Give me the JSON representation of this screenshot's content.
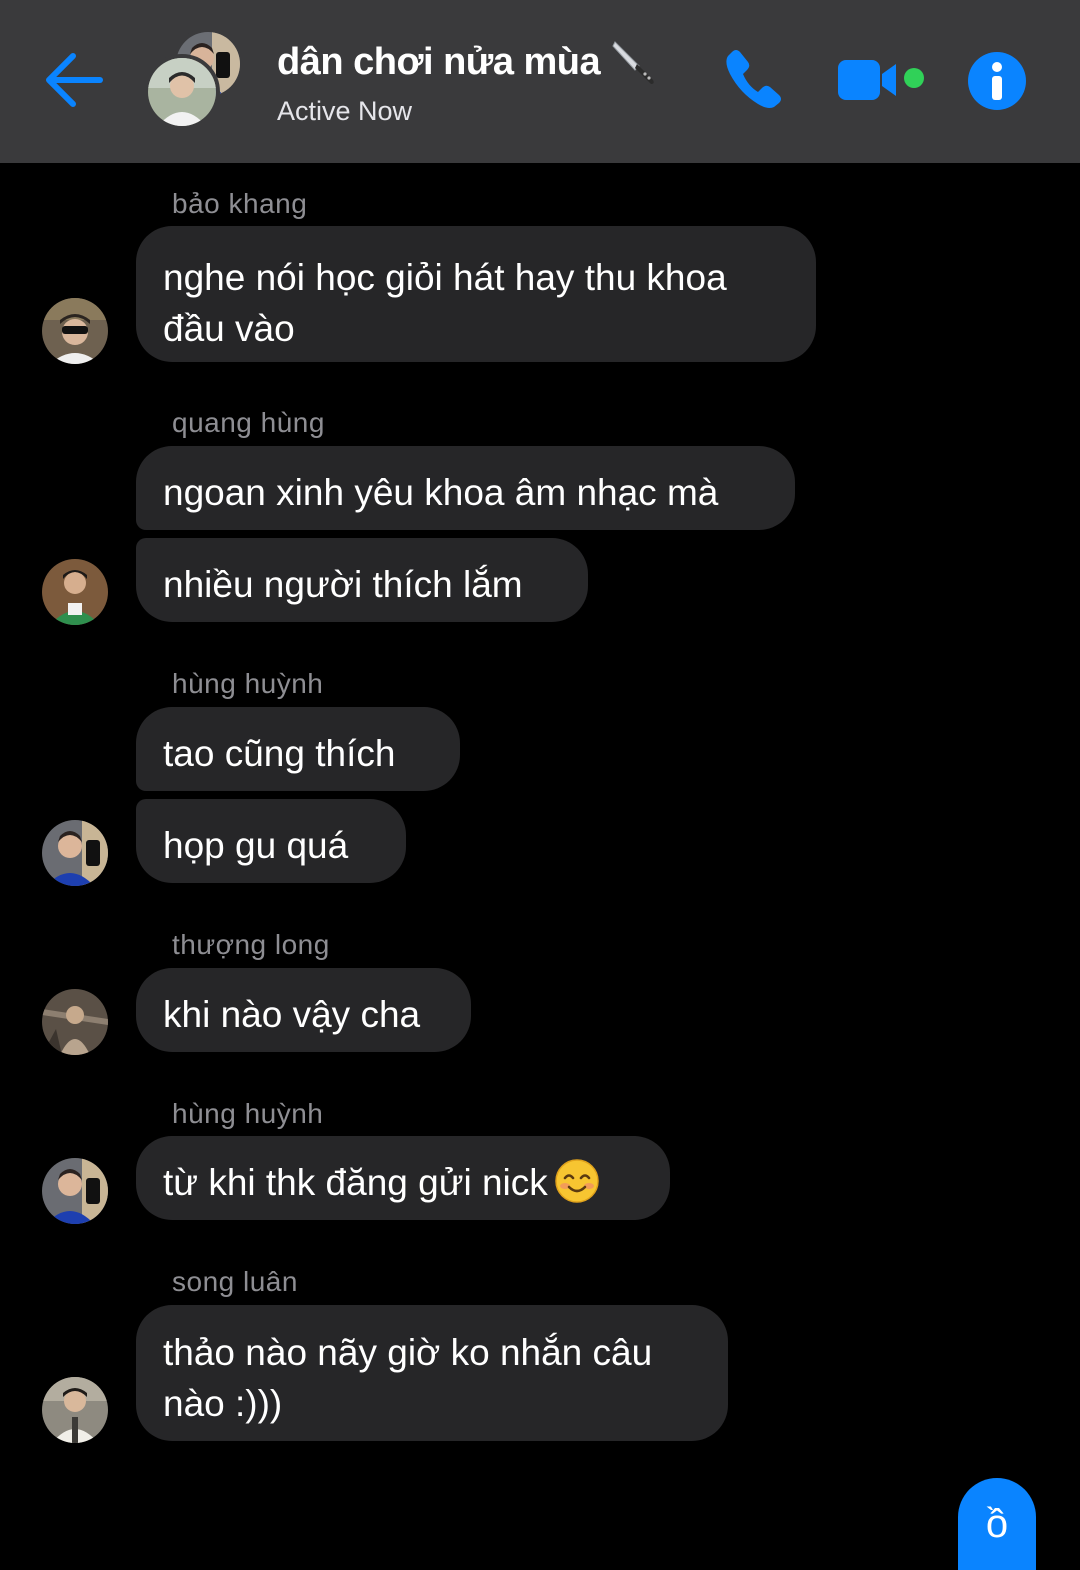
{
  "colors": {
    "header_bg": "#3a3a3c",
    "background": "#000000",
    "accent": "#0a84ff",
    "bubble_bg": "#262628",
    "online_dot": "#30d158",
    "sender_name": "#8e8e93"
  },
  "header": {
    "back_icon": "back-arrow-icon",
    "title": "dân chơi nửa mùa",
    "title_icon": "knife-emoji",
    "status": "Active Now",
    "actions": [
      "phone-icon",
      "video-camera-icon",
      "info-icon"
    ]
  },
  "messages": [
    {
      "sender": "bảo khang",
      "bubbles": [
        "nghe nói học giỏi hát hay thu khoa",
        "đầu vào"
      ]
    },
    {
      "sender": "quang hùng",
      "bubbles": [
        "ngoan xinh yêu khoa âm nhạc mà",
        "nhiều người thích lắm"
      ]
    },
    {
      "sender": "hùng huỳnh",
      "bubbles": [
        "tao cũng thích",
        "họp gu quá"
      ]
    },
    {
      "sender": "thượng long",
      "bubbles": [
        "khi nào vậy cha"
      ]
    },
    {
      "sender": "hùng huỳnh",
      "bubbles": [
        "từ khi thk đăng gửi nick"
      ],
      "emoji": "smiling-face-emoji"
    },
    {
      "sender": "song luân",
      "bubbles": [
        "thảo nào nãy giờ ko nhắn câu",
        "nào :)))"
      ]
    }
  ],
  "composer": {
    "partial_text": "ồ"
  }
}
